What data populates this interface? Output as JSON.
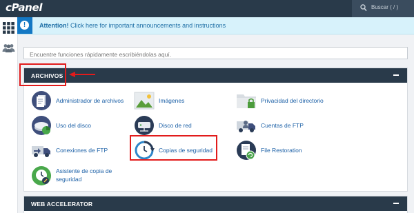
{
  "topbar": {
    "logo": "cPanel",
    "search_label": "Buscar ( / )"
  },
  "notice": {
    "bold": "Attention!",
    "text": " Click here for important announcements and instructions"
  },
  "search": {
    "placeholder": "Encuentre funciones rápidamente escribiéndolas aquí."
  },
  "archivos": {
    "title": "ARCHIVOS",
    "items": [
      {
        "label": "Administrador de archivos",
        "icon": "file-manager-icon"
      },
      {
        "label": "Imágenes",
        "icon": "images-icon"
      },
      {
        "label": "Privacidad del directorio",
        "icon": "directory-privacy-icon"
      },
      {
        "label": "Uso del disco",
        "icon": "disk-usage-icon"
      },
      {
        "label": "Disco de red",
        "icon": "network-disk-icon"
      },
      {
        "label": "Cuentas de FTP",
        "icon": "ftp-accounts-icon"
      },
      {
        "label": "Conexiones de FTP",
        "icon": "ftp-connections-icon"
      },
      {
        "label": "Copias de seguridad",
        "icon": "backup-icon"
      },
      {
        "label": "File Restoration",
        "icon": "file-restoration-icon"
      },
      {
        "label": "Asistente de copia de",
        "label2": "seguridad",
        "icon": "backup-wizard-icon"
      }
    ]
  },
  "web_accelerator": {
    "title": "WEB ACCELERATOR"
  },
  "colors": {
    "topbar": "#293a4a",
    "link": "#1a5fa6",
    "notice_bg": "#d7f2fb",
    "highlight": "#e21b1b"
  }
}
